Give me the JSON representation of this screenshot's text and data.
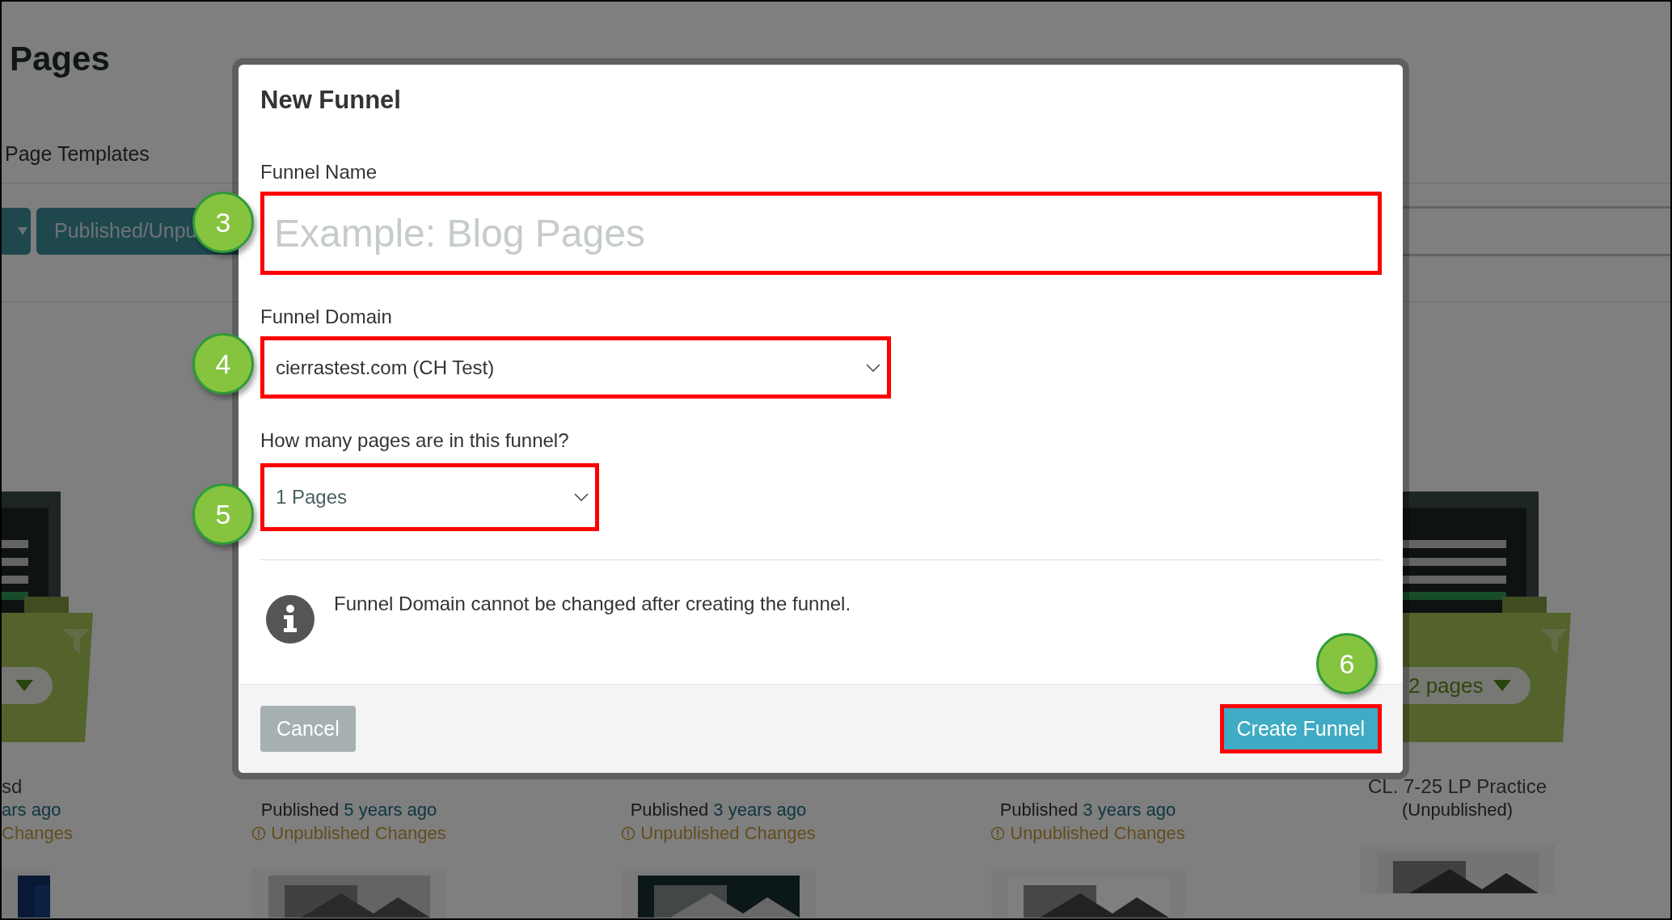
{
  "page": {
    "title": "Pages",
    "tab": "Page Templates",
    "filter_button": "Published/Unpu"
  },
  "cards": [
    {
      "kind": "cut",
      "title": "sd",
      "status_time": "ars ago",
      "changes": "Changes",
      "folder": true
    },
    {
      "kind": "full",
      "status_text": "Published",
      "status_time": "5 years ago",
      "changes": "Unpublished Changes",
      "folder": false
    },
    {
      "kind": "full",
      "status_text": "Published",
      "status_time": "3 years ago",
      "changes": "Unpublished Changes",
      "folder": false
    },
    {
      "kind": "full",
      "status_text": "Published",
      "status_time": "3 years ago",
      "changes": "Unpublished Changes",
      "folder": false
    },
    {
      "kind": "full",
      "title": "CL. 7-25 LP Practice",
      "status_text": "(Unpublished)",
      "folder": true,
      "folder_pill": "2 pages"
    }
  ],
  "dialog": {
    "title": "New Funnel",
    "fields": [
      {
        "kind": "text",
        "label": "Funnel Name",
        "placeholder": "Example: Blog Pages",
        "highlighted": true,
        "callout": "3"
      },
      {
        "kind": "select",
        "label": "Funnel Domain",
        "value": "cierrastest.com (CH Test)",
        "highlighted": true,
        "callout": "4"
      },
      {
        "kind": "select",
        "label": "How many pages are in this funnel?",
        "value": "1 Pages",
        "highlighted": true,
        "callout": "5"
      }
    ],
    "note": "Funnel Domain cannot be changed after creating the funnel.",
    "buttons": [
      {
        "kind": "secondary",
        "label": "Cancel",
        "highlighted": false
      },
      {
        "kind": "primary",
        "label": "Create Funnel",
        "highlighted": true,
        "callout": "6"
      }
    ]
  }
}
